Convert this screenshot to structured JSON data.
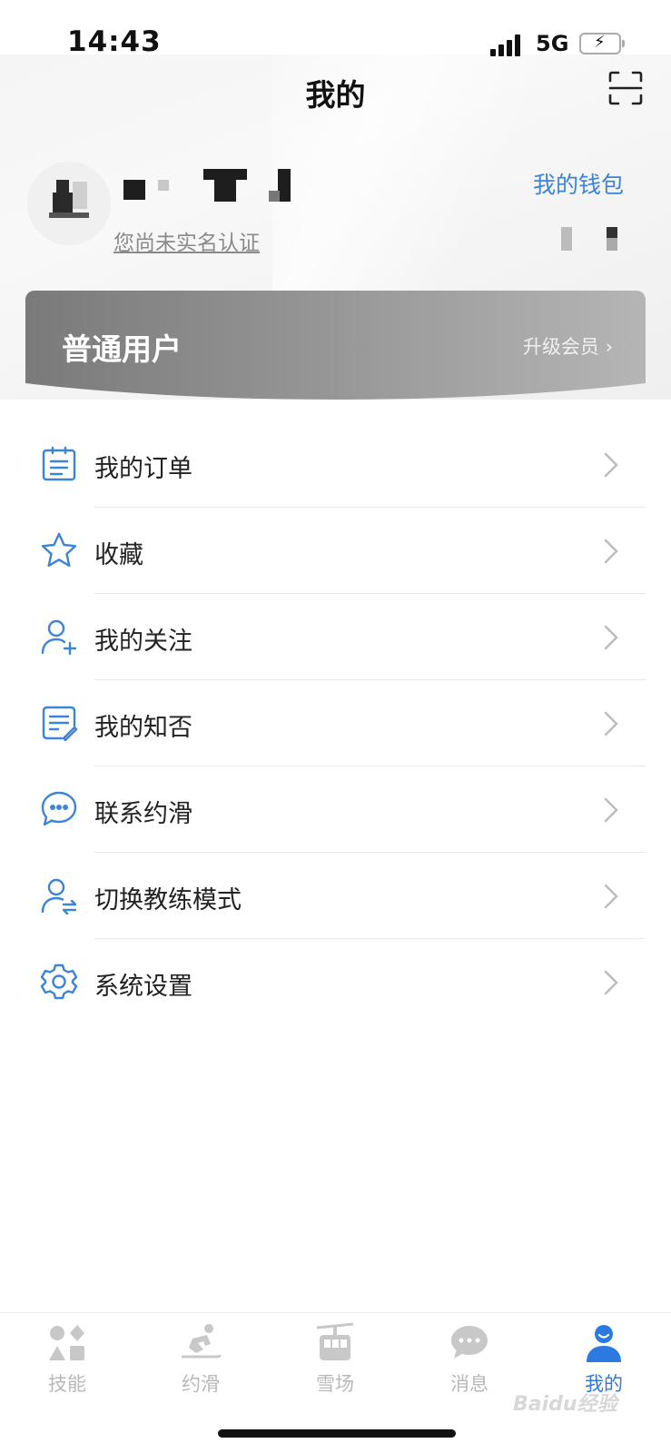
{
  "status_bar": {
    "time": "14:43",
    "network": "5G"
  },
  "header": {
    "title": "我的",
    "scan_icon": "scan-icon"
  },
  "profile": {
    "verify_text": "您尚未实名认证",
    "wallet_label": "我的钱包"
  },
  "member": {
    "level": "普通用户",
    "upgrade_label": "升级会员 ›"
  },
  "menu": [
    {
      "label": "我的订单",
      "icon": "order-list-icon"
    },
    {
      "label": "收藏",
      "icon": "star-icon"
    },
    {
      "label": "我的关注",
      "icon": "add-user-icon"
    },
    {
      "label": "我的知否",
      "icon": "notes-icon"
    },
    {
      "label": "联系约滑",
      "icon": "chat-bubble-icon"
    },
    {
      "label": "切换教练模式",
      "icon": "switch-user-icon"
    },
    {
      "label": "系统设置",
      "icon": "gear-icon"
    }
  ],
  "tabs": [
    {
      "label": "技能",
      "icon": "skills-icon",
      "active": false
    },
    {
      "label": "约滑",
      "icon": "skier-icon",
      "active": false
    },
    {
      "label": "雪场",
      "icon": "cable-car-icon",
      "active": false
    },
    {
      "label": "消息",
      "icon": "message-icon",
      "active": false
    },
    {
      "label": "我的",
      "icon": "profile-icon",
      "active": true
    }
  ],
  "watermark": "Baidu经验",
  "colors": {
    "accent": "#2c7ae0",
    "icon_blue": "#3c84d6",
    "inactive": "#b8b8b8"
  }
}
